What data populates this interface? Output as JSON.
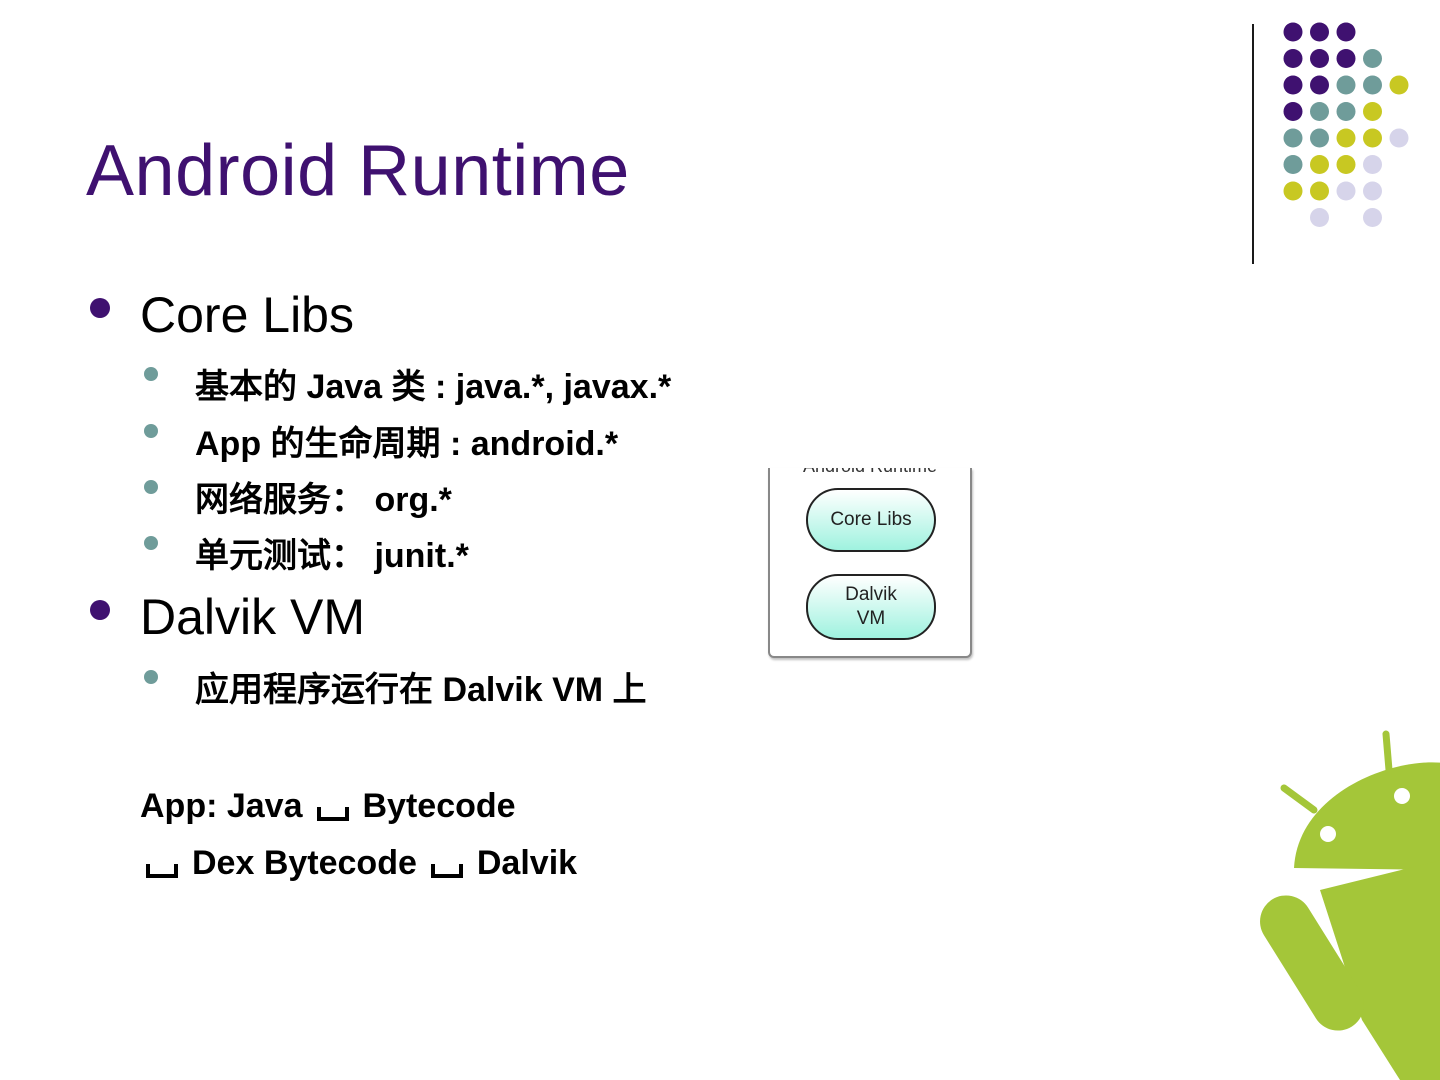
{
  "slide": {
    "title": "Android Runtime",
    "colors": {
      "title": "#3f1170",
      "bullet1": "#3f1170",
      "bullet2": "#6f9c9a",
      "android_green": "#a4c639"
    },
    "bullets": [
      {
        "text": "Core Libs",
        "sub": [
          "基本的 Java 类 : java.*, javax.*",
          "App 的生命周期 : android.*",
          "网络服务： org.*",
          "单元测试： junit.*"
        ]
      },
      {
        "text": "Dalvik VM",
        "sub": [
          "应用程序运行在 Dalvik VM 上"
        ]
      }
    ],
    "flow": {
      "line1_a": "App: Java",
      "line1_b": "Bytecode",
      "line2_a": "Dex Bytecode",
      "line2_b": "Dalvik"
    },
    "diagram": {
      "caption": "Android Runtime",
      "box1": "Core Libs",
      "box2_line1": "Dalvik",
      "box2_line2": "VM"
    }
  }
}
